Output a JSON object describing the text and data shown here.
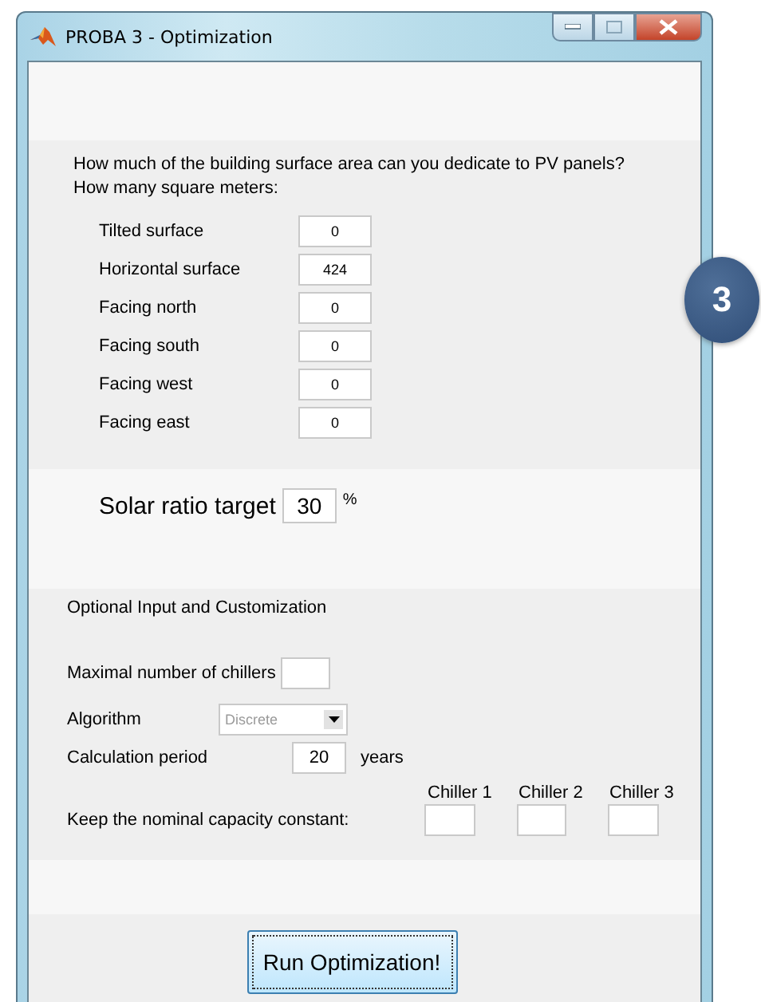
{
  "window": {
    "title": "PROBA 3 - Optimization"
  },
  "badge": "3",
  "surface_section": {
    "question": "How much of the building surface area can you dedicate to PV panels?",
    "subquestion": "How many square meters:",
    "fields": [
      {
        "label": "Tilted surface",
        "value": "0"
      },
      {
        "label": "Horizontal surface",
        "value": "424"
      },
      {
        "label": "Facing north",
        "value": "0"
      },
      {
        "label": "Facing south",
        "value": "0"
      },
      {
        "label": "Facing west",
        "value": "0"
      },
      {
        "label": "Facing east",
        "value": "0"
      }
    ]
  },
  "solar_ratio": {
    "label": "Solar ratio target",
    "value": "30",
    "unit": "%"
  },
  "optional_section": {
    "title": "Optional Input and Customization",
    "max_chillers": {
      "label": "Maximal number of chillers"
    },
    "algorithm": {
      "label": "Algorithm",
      "value": "Discrete",
      "disabled": true
    },
    "calculation_period": {
      "label": "Calculation period",
      "value": "20",
      "unit": "years"
    },
    "nominal_capacity": {
      "label": "Keep the nominal capacity constant:",
      "chillers": [
        {
          "label": "Chiller 1"
        },
        {
          "label": "Chiller 2"
        },
        {
          "label": "Chiller 3"
        }
      ]
    }
  },
  "run_button": "Run Optimization!"
}
